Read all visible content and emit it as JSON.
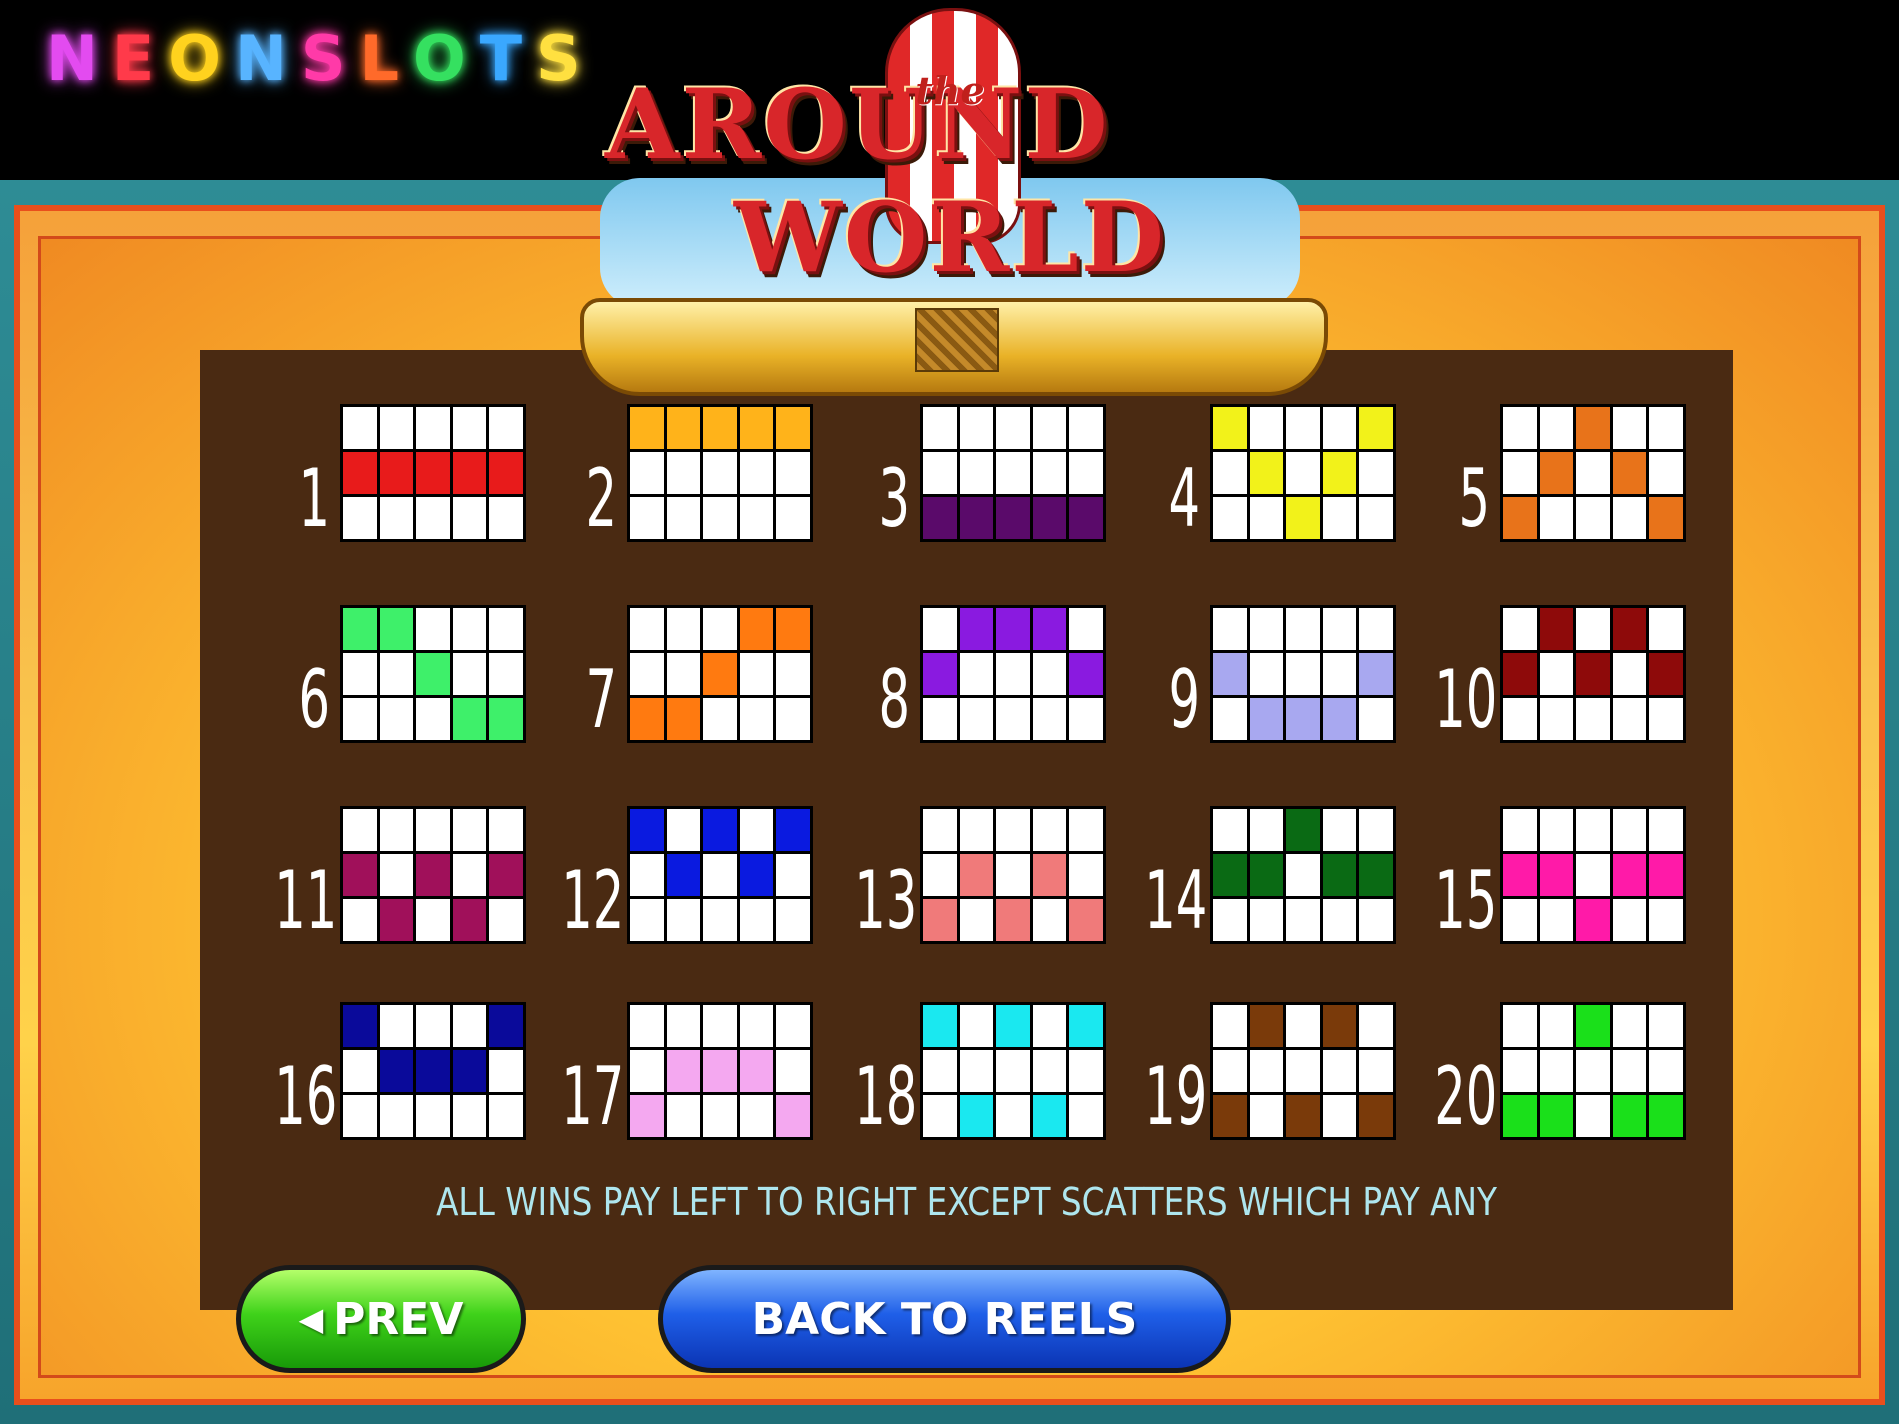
{
  "brand": {
    "letters": [
      "N",
      "E",
      "O",
      "N",
      "S",
      "L",
      "O",
      "T",
      "S"
    ],
    "letter_colors": [
      "#e34bf0",
      "#ff3a4a",
      "#ffd21e",
      "#58b4ff",
      "#ff3aa8",
      "#ff6a2a",
      "#35e060",
      "#3aa8ff",
      "#ffe040"
    ]
  },
  "logo": {
    "title_left": "AROUND",
    "title_mid": "the",
    "title_right": "WORLD"
  },
  "paylines": [
    {
      "number": "1",
      "color": "#e81b1b",
      "rows": [
        [
          0,
          0,
          0,
          0,
          0
        ],
        [
          1,
          1,
          1,
          1,
          1
        ],
        [
          0,
          0,
          0,
          0,
          0
        ]
      ]
    },
    {
      "number": "2",
      "color": "#ffb31a",
      "rows": [
        [
          1,
          1,
          1,
          1,
          1
        ],
        [
          0,
          0,
          0,
          0,
          0
        ],
        [
          0,
          0,
          0,
          0,
          0
        ]
      ]
    },
    {
      "number": "3",
      "color": "#5a0a6a",
      "rows": [
        [
          0,
          0,
          0,
          0,
          0
        ],
        [
          0,
          0,
          0,
          0,
          0
        ],
        [
          1,
          1,
          1,
          1,
          1
        ]
      ]
    },
    {
      "number": "4",
      "color": "#f2f21a",
      "rows": [
        [
          1,
          0,
          0,
          0,
          1
        ],
        [
          0,
          1,
          0,
          1,
          0
        ],
        [
          0,
          0,
          1,
          0,
          0
        ]
      ]
    },
    {
      "number": "5",
      "color": "#e8731a",
      "rows": [
        [
          0,
          0,
          1,
          0,
          0
        ],
        [
          0,
          1,
          0,
          1,
          0
        ],
        [
          1,
          0,
          0,
          0,
          1
        ]
      ]
    },
    {
      "number": "6",
      "color": "#3ef06a",
      "rows": [
        [
          1,
          1,
          0,
          0,
          0
        ],
        [
          0,
          0,
          1,
          0,
          0
        ],
        [
          0,
          0,
          0,
          1,
          1
        ]
      ]
    },
    {
      "number": "7",
      "color": "#ff7a10",
      "rows": [
        [
          0,
          0,
          0,
          1,
          1
        ],
        [
          0,
          0,
          1,
          0,
          0
        ],
        [
          1,
          1,
          0,
          0,
          0
        ]
      ]
    },
    {
      "number": "8",
      "color": "#8a1ae0",
      "rows": [
        [
          0,
          1,
          1,
          1,
          0
        ],
        [
          1,
          0,
          0,
          0,
          1
        ],
        [
          0,
          0,
          0,
          0,
          0
        ]
      ]
    },
    {
      "number": "9",
      "color": "#a8a8f0",
      "rows": [
        [
          0,
          0,
          0,
          0,
          0
        ],
        [
          1,
          0,
          0,
          0,
          1
        ],
        [
          0,
          1,
          1,
          1,
          0
        ]
      ]
    },
    {
      "number": "10",
      "color": "#8e0a0a",
      "rows": [
        [
          0,
          1,
          0,
          1,
          0
        ],
        [
          1,
          0,
          1,
          0,
          1
        ],
        [
          0,
          0,
          0,
          0,
          0
        ]
      ]
    },
    {
      "number": "11",
      "color": "#a0105a",
      "rows": [
        [
          0,
          0,
          0,
          0,
          0
        ],
        [
          1,
          0,
          1,
          0,
          1
        ],
        [
          0,
          1,
          0,
          1,
          0
        ]
      ]
    },
    {
      "number": "12",
      "color": "#0a1ae0",
      "rows": [
        [
          1,
          0,
          1,
          0,
          1
        ],
        [
          0,
          1,
          0,
          1,
          0
        ],
        [
          0,
          0,
          0,
          0,
          0
        ]
      ]
    },
    {
      "number": "13",
      "color": "#f07a7a",
      "rows": [
        [
          0,
          0,
          0,
          0,
          0
        ],
        [
          0,
          1,
          0,
          1,
          0
        ],
        [
          1,
          0,
          1,
          0,
          1
        ]
      ]
    },
    {
      "number": "14",
      "color": "#0a6a14",
      "rows": [
        [
          0,
          0,
          1,
          0,
          0
        ],
        [
          1,
          1,
          0,
          1,
          1
        ],
        [
          0,
          0,
          0,
          0,
          0
        ]
      ]
    },
    {
      "number": "15",
      "color": "#ff1aa8",
      "rows": [
        [
          0,
          0,
          0,
          0,
          0
        ],
        [
          1,
          1,
          0,
          1,
          1
        ],
        [
          0,
          0,
          1,
          0,
          0
        ]
      ]
    },
    {
      "number": "16",
      "color": "#0a0a9a",
      "rows": [
        [
          1,
          0,
          0,
          0,
          1
        ],
        [
          0,
          1,
          1,
          1,
          0
        ],
        [
          0,
          0,
          0,
          0,
          0
        ]
      ]
    },
    {
      "number": "17",
      "color": "#f4a8f0",
      "rows": [
        [
          0,
          0,
          0,
          0,
          0
        ],
        [
          0,
          1,
          1,
          1,
          0
        ],
        [
          1,
          0,
          0,
          0,
          1
        ]
      ]
    },
    {
      "number": "18",
      "color": "#1ae8f0",
      "rows": [
        [
          1,
          0,
          1,
          0,
          1
        ],
        [
          0,
          0,
          0,
          0,
          0
        ],
        [
          0,
          1,
          0,
          1,
          0
        ]
      ]
    },
    {
      "number": "19",
      "color": "#7a3a0a",
      "rows": [
        [
          0,
          1,
          0,
          1,
          0
        ],
        [
          0,
          0,
          0,
          0,
          0
        ],
        [
          1,
          0,
          1,
          0,
          1
        ]
      ]
    },
    {
      "number": "20",
      "color": "#1ae01a",
      "rows": [
        [
          0,
          0,
          1,
          0,
          0
        ],
        [
          0,
          0,
          0,
          0,
          0
        ],
        [
          1,
          1,
          0,
          1,
          1
        ]
      ]
    }
  ],
  "notice": "ALL WINS PAY LEFT TO RIGHT EXCEPT SCATTERS WHICH PAY ANY",
  "buttons": {
    "prev_arrow": "◀",
    "prev_label": "PREV",
    "back_label": "BACK TO REELS"
  }
}
